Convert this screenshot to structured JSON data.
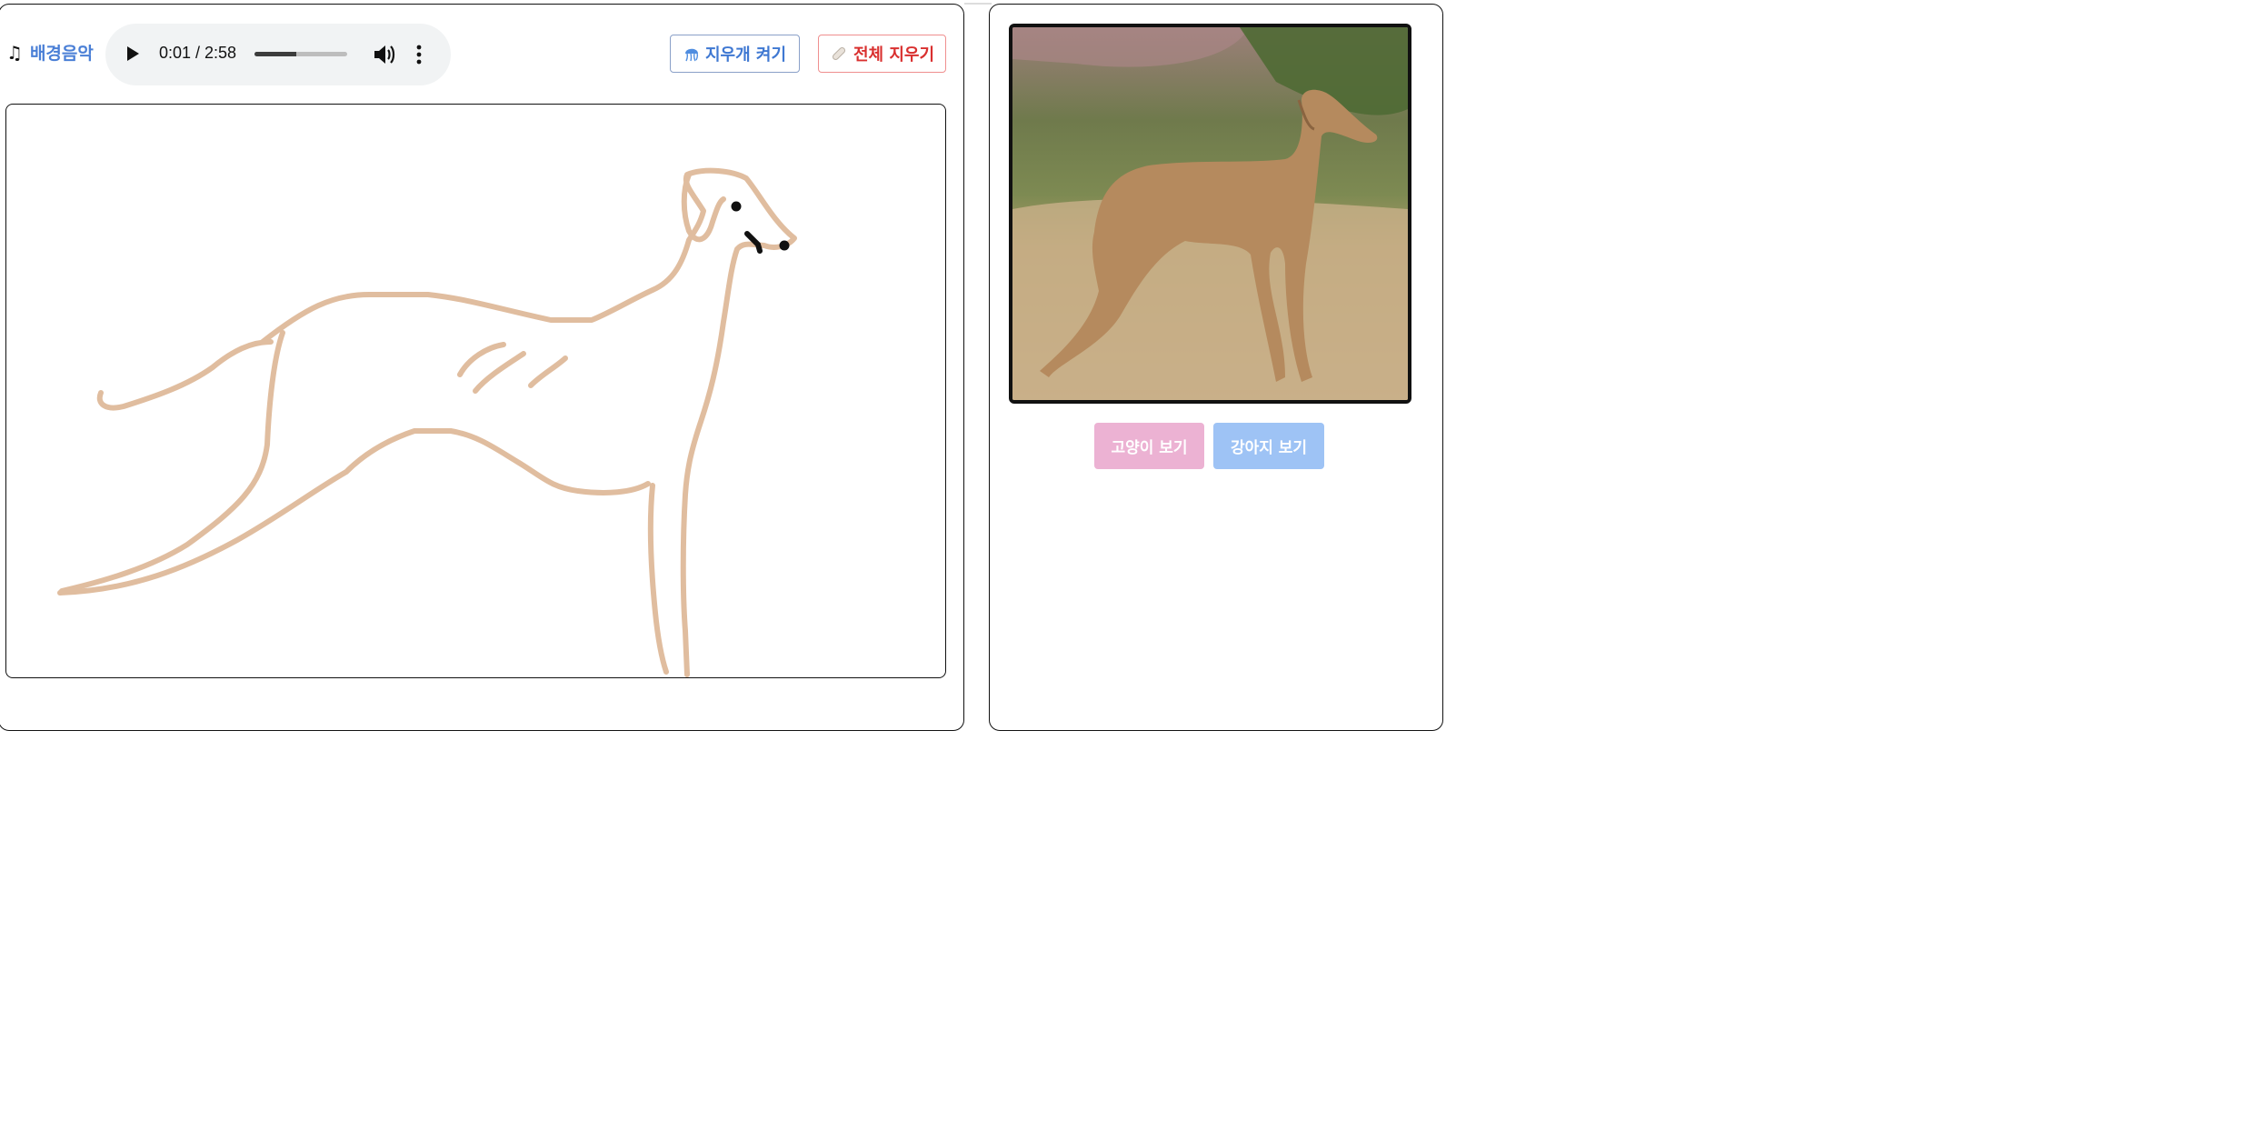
{
  "music": {
    "label": "배경음악",
    "note_icon": "music-note-icon"
  },
  "audio_player": {
    "time": "0:01 / 2:58",
    "progress": 0.006,
    "buffered_display_fraction": 0.45,
    "play_icon": "play-icon",
    "volume_icon": "volume-icon",
    "more_icon": "more-vert-icon"
  },
  "toolbar": {
    "eraser_label": "지우개 켜기",
    "eraser_icon": "jellyfish-icon",
    "clear_label": "전체 지우기",
    "clear_icon": "bandage-icon"
  },
  "drawing": {
    "stroke_color": "#e0bd9f",
    "ink_color": "#111111"
  },
  "reference": {
    "subject": "dog photo"
  },
  "view_buttons": {
    "cat": "고양이 보기",
    "dog": "강아지 보기"
  },
  "colors": {
    "accent_blue": "#3f78d2",
    "danger_red": "#d9302f",
    "cat_pink": "#ecb2d3",
    "dog_blue": "#9ec3f5"
  }
}
